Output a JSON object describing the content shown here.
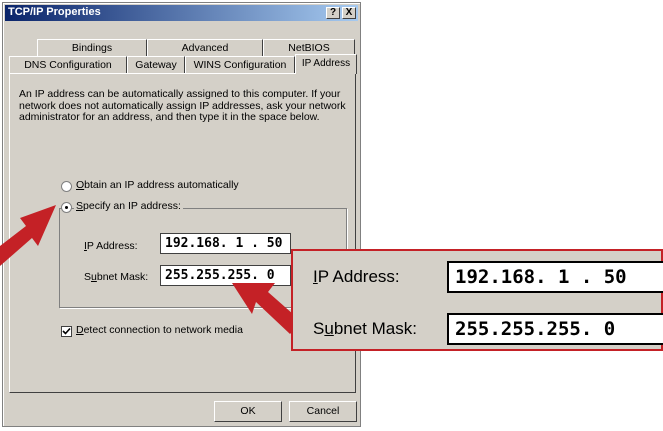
{
  "window": {
    "title": "TCP/IP Properties",
    "help_button": "?",
    "close_button": "X"
  },
  "tabs_row1": [
    {
      "label": "Bindings"
    },
    {
      "label": "Advanced"
    },
    {
      "label": "NetBIOS"
    }
  ],
  "tabs_row2": [
    {
      "label": "DNS Configuration"
    },
    {
      "label": "Gateway"
    },
    {
      "label": "WINS Configuration"
    },
    {
      "label": "IP Address",
      "active": true
    }
  ],
  "description": "An IP address can be automatically assigned to this computer. If your network does not automatically assign IP addresses, ask your network administrator for an address, and then type it in the space below.",
  "options": {
    "auto": {
      "accel": "O",
      "rest": "btain an IP address automatically",
      "selected": false
    },
    "specify": {
      "accel": "S",
      "rest": "pecify an IP address:",
      "selected": true
    }
  },
  "fields": {
    "ip_label_accel": "I",
    "ip_label_rest": "P Address:",
    "ip_value": "192.168. 1 . 50",
    "subnet_label_pre": "S",
    "subnet_label_accel": "u",
    "subnet_label_rest": "bnet Mask:",
    "subnet_value": "255.255.255. 0"
  },
  "detect": {
    "accel": "D",
    "rest": "etect connection to network media",
    "checked": true
  },
  "buttons": {
    "ok": "OK",
    "cancel": "Cancel"
  },
  "callout_color": "#c42126"
}
